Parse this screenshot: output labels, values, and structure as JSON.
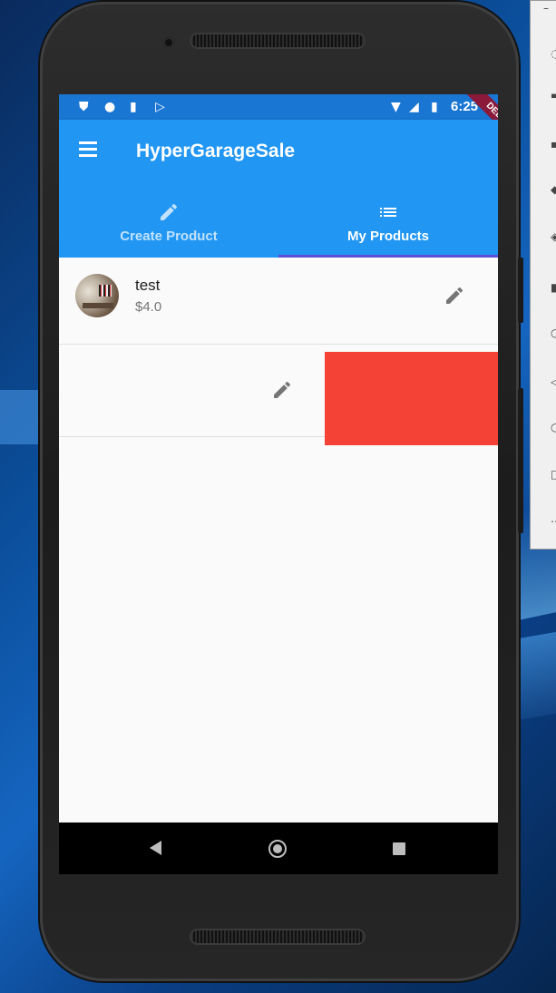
{
  "app": {
    "title": "HyperGarageSale",
    "debug_banner": "DEBUG"
  },
  "status_bar": {
    "time": "6:25",
    "icons": [
      "shield-icon",
      "circle-icon",
      "sd-card-icon",
      "play-store-icon",
      "wifi-icon",
      "signal-icon",
      "battery-icon"
    ]
  },
  "tabs": [
    {
      "label": "Create Product",
      "icon": "pencil-icon",
      "selected": false
    },
    {
      "label": "My Products",
      "icon": "list-icon",
      "selected": true
    }
  ],
  "products": [
    {
      "title": "test",
      "price": "$4.0",
      "thumbnail": "product-photo"
    },
    {
      "title": "",
      "price": "",
      "swipe_action_color": "#f44336"
    }
  ],
  "nav_bar": {
    "buttons": [
      "back-icon",
      "home-icon",
      "recents-icon"
    ]
  },
  "colors": {
    "app_bar": "#2196f3",
    "status_bar": "#1976d2",
    "tab_indicator": "#5c4fd6",
    "swipe_delete": "#f44336"
  }
}
